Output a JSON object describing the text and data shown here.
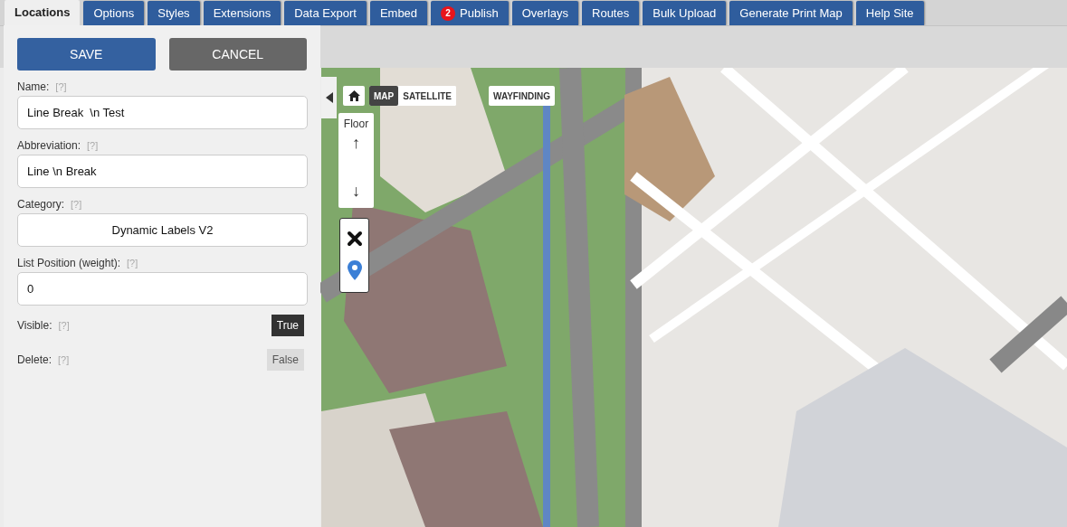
{
  "tabs": [
    {
      "label": "Locations",
      "selected": true
    },
    {
      "label": "Options",
      "selected": false
    },
    {
      "label": "Styles",
      "selected": false
    },
    {
      "label": "Extensions",
      "selected": false
    },
    {
      "label": "Data Export",
      "selected": false
    },
    {
      "label": "Embed",
      "selected": false
    },
    {
      "label": "Publish",
      "selected": false,
      "badge": "2"
    },
    {
      "label": "Overlays",
      "selected": false
    },
    {
      "label": "Routes",
      "selected": false
    },
    {
      "label": "Bulk Upload",
      "selected": false
    },
    {
      "label": "Generate Print Map",
      "selected": false
    },
    {
      "label": "Help Site",
      "selected": false
    }
  ],
  "panel": {
    "buttons": [
      {
        "label": "SAVE",
        "kind": "primary"
      },
      {
        "label": "CANCEL",
        "kind": "secondary"
      }
    ],
    "fields": [
      {
        "kind": "text",
        "label": "Name:",
        "help": "[?]",
        "value": "Line Break  \\n Test"
      },
      {
        "kind": "text",
        "label": "Abbreviation:",
        "help": "[?]",
        "value": "Line \\n Break"
      },
      {
        "kind": "select",
        "label": "Category:",
        "help": "[?]",
        "value": "Dynamic Labels V2"
      },
      {
        "kind": "text",
        "label": "List Position (weight):",
        "help": "[?]",
        "value": "0"
      },
      {
        "kind": "toggle",
        "label": "Visible:",
        "help": "[?]",
        "value": "True",
        "on": true
      },
      {
        "kind": "toggle",
        "label": "Delete:",
        "help": "[?]",
        "value": "False",
        "on": false
      }
    ]
  },
  "map": {
    "map_types": [
      {
        "label": "MAP",
        "selected": true
      },
      {
        "label": "SATELLITE",
        "selected": false
      }
    ],
    "wayfinding": "WAYFINDING",
    "floor": {
      "label": "Floor",
      "up": "↑",
      "down": "↓"
    }
  }
}
